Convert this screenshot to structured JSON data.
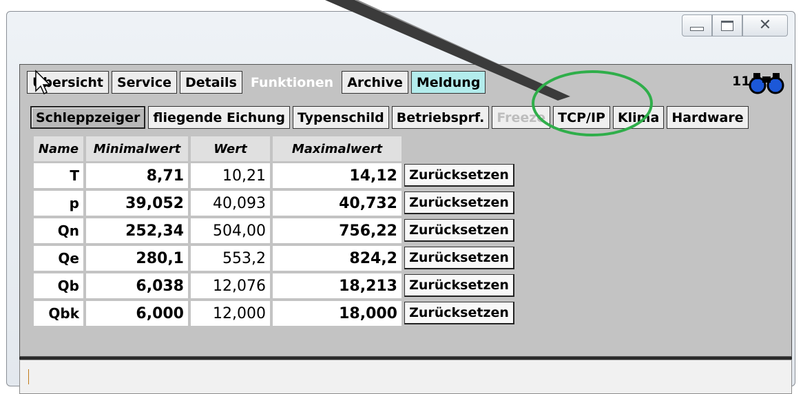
{
  "window": {
    "controls": [
      "minimize-icon",
      "maximize-icon",
      "close-icon"
    ]
  },
  "tabs": [
    {
      "label": "Übersicht"
    },
    {
      "label": "Service"
    },
    {
      "label": "Details"
    },
    {
      "label": "Funktionen"
    },
    {
      "label": "Archive"
    },
    {
      "label": "Meldung"
    }
  ],
  "header": {
    "time": "11:"
  },
  "subtabs": [
    {
      "label": "Schleppzeiger"
    },
    {
      "label": "fliegende Eichung"
    },
    {
      "label": "Typenschild"
    },
    {
      "label": "Betriebsprf."
    },
    {
      "label": "Freeze"
    },
    {
      "label": "TCP/IP"
    },
    {
      "label": "Klima"
    },
    {
      "label": "Hardware"
    }
  ],
  "table": {
    "columns": [
      "Name",
      "Minimalwert",
      "Wert",
      "Maximalwert"
    ],
    "rows": [
      {
        "name": "T",
        "min": "8,71",
        "wert": "10,21",
        "max": "14,12"
      },
      {
        "name": "p",
        "min": "39,052",
        "wert": "40,093",
        "max": "40,732"
      },
      {
        "name": "Qn",
        "min": "252,34",
        "wert": "504,00",
        "max": "756,22"
      },
      {
        "name": "Qe",
        "min": "280,1",
        "wert": "553,2",
        "max": "824,2"
      },
      {
        "name": "Qb",
        "min": "6,038",
        "wert": "12,076",
        "max": "18,213"
      },
      {
        "name": "Qbk",
        "min": "6,000",
        "wert": "12,000",
        "max": "18,000"
      }
    ],
    "reset_label": "Zurücksetzen"
  },
  "colors": {
    "highlight_circle": "#2fae4a",
    "panel": "#c3c3c3",
    "meldung_tab": "#b3ecec"
  }
}
